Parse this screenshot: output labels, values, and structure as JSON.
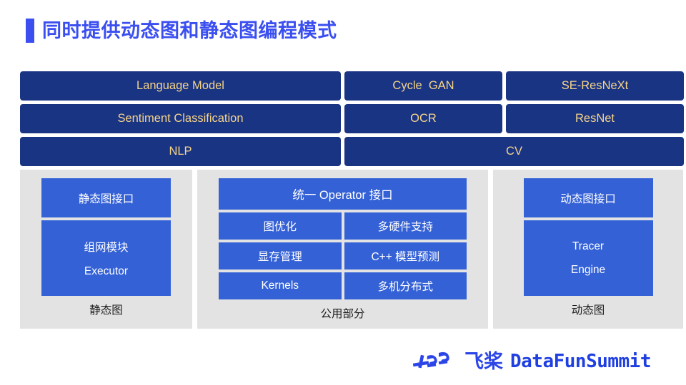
{
  "title": {
    "text": "同时提供动态图和静态图编程模式",
    "accent_color": "#3b4ff0"
  },
  "colors": {
    "navy": "#1a3484",
    "navy_text": "#f6d589",
    "royal_blue": "#3461d6",
    "panel_gray": "#e3e3e3",
    "title_blue": "#3b4ff0",
    "logo_blue": "#1f3fe0"
  },
  "model_stack": {
    "rows": [
      {
        "boxes": [
          {
            "label": "Language Model",
            "span": "left"
          },
          {
            "label": "Cycle  GAN",
            "span": "mid"
          },
          {
            "label": "SE-ResNeXt",
            "span": "right"
          }
        ]
      },
      {
        "boxes": [
          {
            "label": "Sentiment Classification",
            "span": "left"
          },
          {
            "label": "OCR",
            "span": "mid"
          },
          {
            "label": "ResNet",
            "span": "right"
          }
        ]
      },
      {
        "boxes": [
          {
            "label": "NLP",
            "span": "left"
          },
          {
            "label": "CV",
            "span": "wide"
          }
        ]
      }
    ]
  },
  "panels": {
    "static_graph": {
      "caption": "静态图",
      "interface_box": "静态图接口",
      "core_box_lines": [
        "组网模块",
        "Executor"
      ]
    },
    "common": {
      "caption": "公用部分",
      "header_box": "统一 Operator 接口",
      "grid": [
        [
          "图优化",
          "多硬件支持"
        ],
        [
          "显存管理",
          "C++ 模型预测"
        ],
        [
          "Kernels",
          "多机分布式"
        ]
      ]
    },
    "dynamic_graph": {
      "caption": "动态图",
      "interface_box": "动态图接口",
      "core_box_lines": [
        "Tracer",
        "Engine"
      ]
    }
  },
  "footer": {
    "brand_cn": "飞桨",
    "brand_en": "DataFunSummit"
  }
}
